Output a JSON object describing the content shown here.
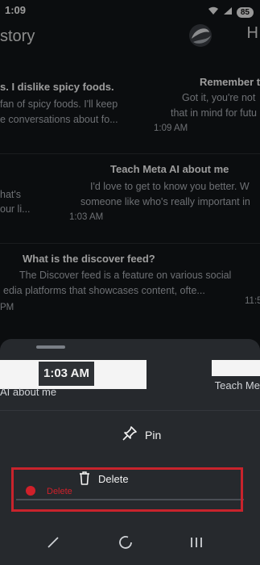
{
  "status": {
    "time": "1:09",
    "battery": "85"
  },
  "header": {
    "title": "story",
    "title_right": "H"
  },
  "history": [
    {
      "title": "s. I dislike spicy foods.",
      "title_right": "Remember t",
      "lines_left": [
        "fan of spicy foods. I'll keep",
        "e conversations about fo..."
      ],
      "lines_right": [
        "Got it, you're not",
        "that in mind for futu"
      ],
      "time": "1:09 AM"
    },
    {
      "title": "Teach Meta AI about me",
      "lines_left": [
        "hat's",
        "our li..."
      ],
      "lines_right": [
        "I'd love to get to know you better. W",
        "someone like who's really important in"
      ],
      "time": "1:03 AM"
    },
    {
      "title": "What is the discover feed?",
      "lines": [
        "The Discover feed is a feature on various social",
        "edia platforms that showcases content, ofte..."
      ],
      "time_left": "PM",
      "time_right": "11:5"
    }
  ],
  "sheet": {
    "preview_time": "1:03 AM",
    "preview_label_left": "AI about me",
    "preview_label_right": "Teach Me",
    "pin_label": "Pin",
    "delete_label": "Delete",
    "delete_ghost_label": "Delete"
  },
  "colors": {
    "highlight": "#c8232c",
    "background": "#121417",
    "sheet": "#26292d"
  },
  "icons": {
    "pin": "pin-icon",
    "delete": "trash-icon",
    "back": "back-icon",
    "home": "home-icon",
    "recents": "recents-icon"
  }
}
